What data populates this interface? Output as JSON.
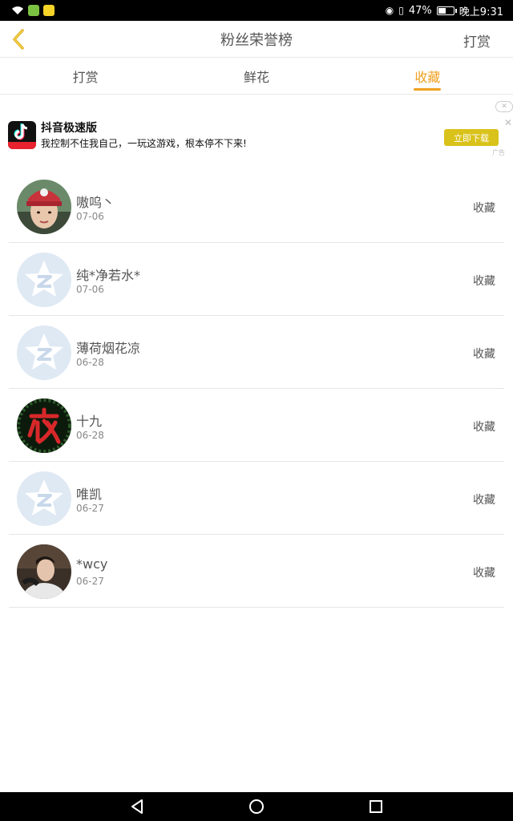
{
  "status_bar": {
    "battery_percent": "47%",
    "time": "晚上9:31",
    "battery_level": 0.47,
    "app_colors": [
      "#7cc242",
      "#f5d327"
    ]
  },
  "header": {
    "title": "粉丝荣誉榜",
    "action": "打赏",
    "back_icon": "chevron-left-icon"
  },
  "tabs": [
    {
      "label": "打赏",
      "active": false
    },
    {
      "label": "鲜花",
      "active": false
    },
    {
      "label": "收藏",
      "active": true
    }
  ],
  "ad": {
    "app_name": "抖音极速版",
    "description": "我控制不住我自己，一玩这游戏，根本停不下来!",
    "button": "立即下载",
    "logo_badge": "极速版",
    "ad_label": "广告"
  },
  "list": [
    {
      "name": "嗷呜丶",
      "date": "07-06",
      "action": "收藏",
      "avatar": "photo-red-hat"
    },
    {
      "name": "纯*净若水*",
      "date": "07-06",
      "action": "收藏",
      "avatar": "default-qzone"
    },
    {
      "name": "薄荷烟花凉",
      "date": "06-28",
      "action": "收藏",
      "avatar": "default-qzone"
    },
    {
      "name": "十九",
      "date": "06-28",
      "action": "收藏",
      "avatar": "night-character"
    },
    {
      "name": "唯凯",
      "date": "06-27",
      "action": "收藏",
      "avatar": "default-qzone"
    },
    {
      "name": "*wcy",
      "date": "06-27",
      "action": "收藏",
      "avatar": "photo-boy"
    }
  ],
  "colors": {
    "accent": "#f0a020",
    "ad_button": "#d9c21a",
    "divider": "#e6e6e6"
  }
}
